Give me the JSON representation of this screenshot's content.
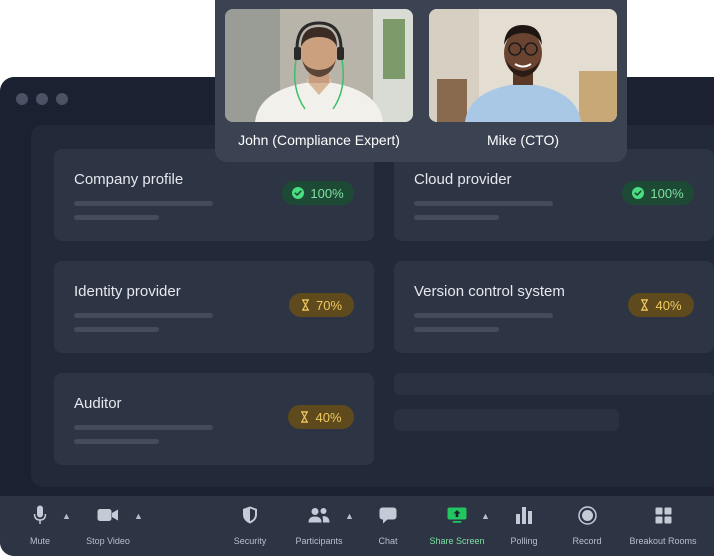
{
  "cards": [
    {
      "title": "Company profile",
      "status": "done",
      "percent": "100%"
    },
    {
      "title": "Cloud provider",
      "status": "done",
      "percent": "100%"
    },
    {
      "title": "Identity provider",
      "status": "pending",
      "percent": "70%"
    },
    {
      "title": "Version control system",
      "status": "pending",
      "percent": "40%"
    },
    {
      "title": "Auditor",
      "status": "pending",
      "percent": "40%"
    }
  ],
  "participants": [
    {
      "name": "John (Compliance Expert)"
    },
    {
      "name": "Mike (CTO)"
    }
  ],
  "toolbar": {
    "mute": "Mute",
    "stop_video": "Stop Video",
    "security": "Security",
    "participants": "Participants",
    "chat": "Chat",
    "share_screen": "Share Screen",
    "polling": "Polling",
    "record": "Record",
    "breakout_rooms": "Breakout Rooms"
  },
  "colors": {
    "window_bg": "#1b2130",
    "card_bg": "#2d3444",
    "done_badge_bg": "#1d4a35",
    "done_text": "#7ee0a0",
    "pending_badge_bg": "#5e4a1d",
    "pending_text": "#f0c860",
    "share_accent": "#22c55e"
  }
}
